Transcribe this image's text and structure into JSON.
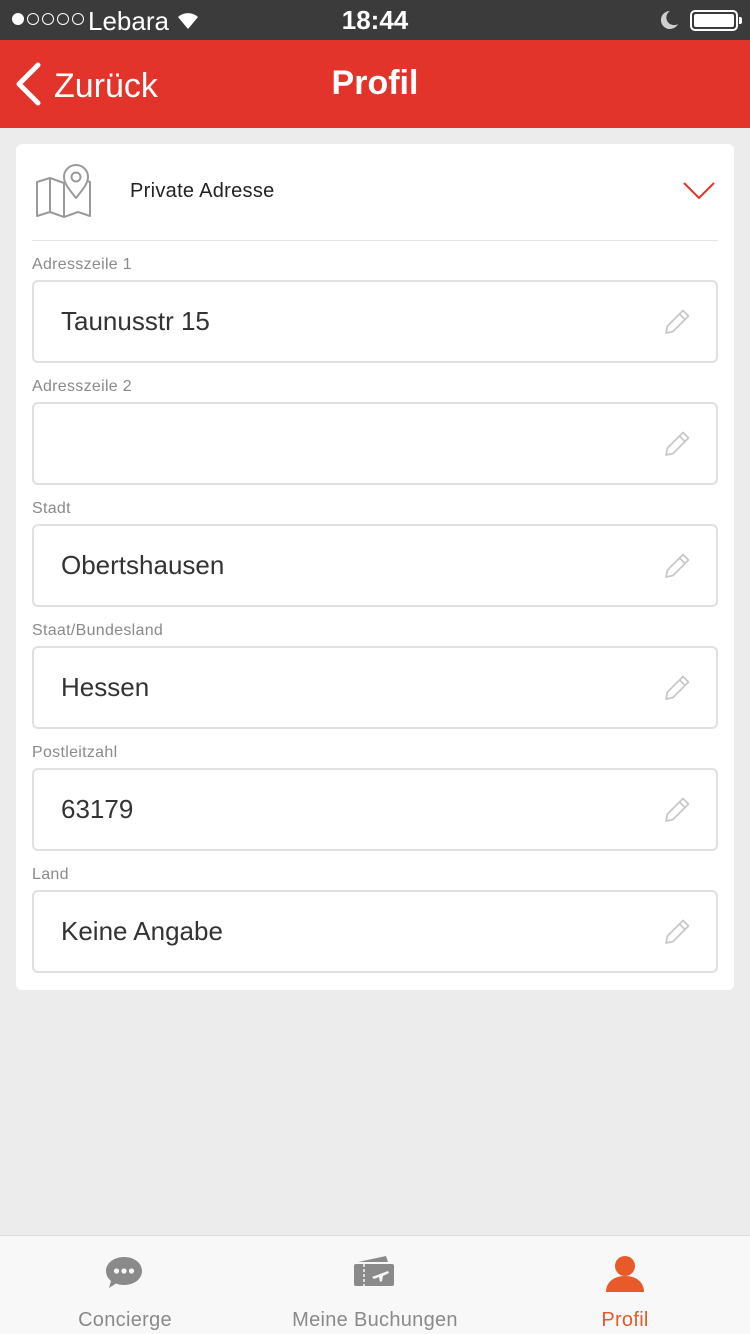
{
  "status_bar": {
    "carrier": "Lebara",
    "time": "18:44",
    "signal_icon": "signal-dots-icon",
    "wifi_icon": "wifi-icon",
    "moon_icon": "moon-icon",
    "battery_icon": "battery-icon"
  },
  "nav": {
    "back_label": "Zurück",
    "title": "Profil",
    "color": "#e2342a"
  },
  "section": {
    "title": "Private Adresse",
    "icon": "map-pin-icon",
    "expand_icon": "chevron-down-icon"
  },
  "fields": [
    {
      "label": "Adresszeile 1",
      "value": "Taunusstr 15"
    },
    {
      "label": "Adresszeile 2",
      "value": ""
    },
    {
      "label": "Stadt",
      "value": "Obertshausen"
    },
    {
      "label": "Staat/Bundesland",
      "value": "Hessen"
    },
    {
      "label": "Postleitzahl",
      "value": "63179"
    },
    {
      "label": "Land",
      "value": "Keine Angabe"
    }
  ],
  "tab_bar": {
    "tabs": [
      {
        "label": "Concierge",
        "icon": "chat-bubble-icon",
        "active": false
      },
      {
        "label": "Meine Buchungen",
        "icon": "ticket-plane-icon",
        "active": false
      },
      {
        "label": "Profil",
        "icon": "person-icon",
        "active": true
      }
    ],
    "active_color": "#e85a2a",
    "inactive_color": "#8a8a8a"
  }
}
